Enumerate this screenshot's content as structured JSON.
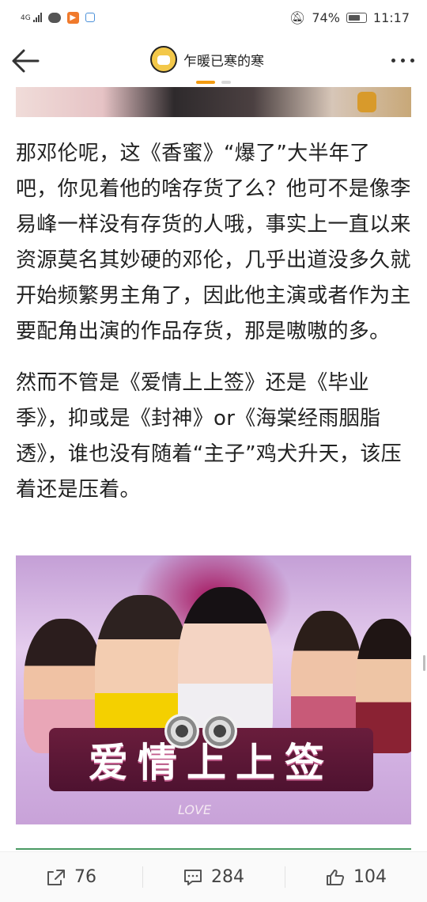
{
  "status_bar": {
    "network": "4G",
    "battery": "74%",
    "time": "11:17"
  },
  "header": {
    "title": "乍暖已寒的寒",
    "avatar_icon": "cartoon-face-avatar"
  },
  "article": {
    "paragraphs": [
      "那邓伦呢，这《香蜜》“爆了”大半年了吧，你见着他的啥存货了么？他可不是像李易峰一样没有存货的人哦，事实上一直以来资源莫名其妙硬的邓伦，几乎出道没多久就开始频繁男主角了，因此他主演或者作为主要配角出演的作品存货，那是嗷嗷的多。",
      "然而不管是《爱情上上签》还是《毕业季》，抑或是《封神》or《海棠经雨胭脂透》，谁也没有随着“主子”鸡犬升天，该压着还是压着。"
    ],
    "poster": {
      "title": "爱情上上签",
      "subtitle": "LOVE"
    }
  },
  "actions": {
    "share_count": "76",
    "comment_count": "284",
    "like_count": "104"
  },
  "colors": {
    "accent": "#f39c12",
    "divider": "#4a9a63"
  }
}
